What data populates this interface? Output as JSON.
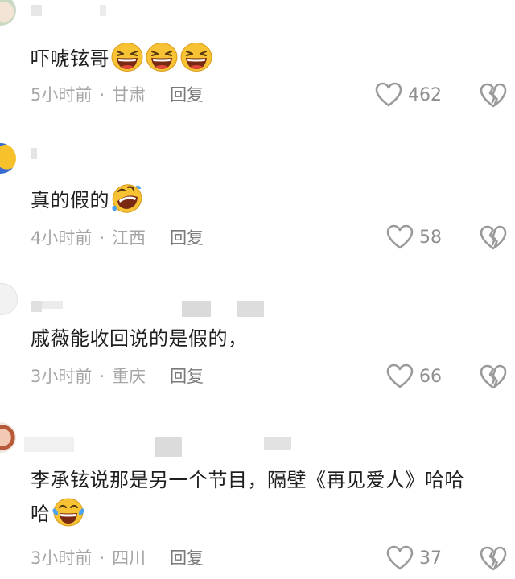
{
  "comments": [
    {
      "text": "吓唬铉哥",
      "emoji": [
        "laughing-face-icon",
        "laughing-face-icon",
        "laughing-face-icon"
      ],
      "time": "5小时前",
      "separator": "·",
      "location": "甘肃",
      "reply": "回复",
      "likes": "462"
    },
    {
      "text": "真的假的",
      "emoji": [
        "rolling-on-floor-laughing-icon"
      ],
      "time": "4小时前",
      "separator": "·",
      "location": "江西",
      "reply": "回复",
      "likes": "58"
    },
    {
      "text": "戚薇能收回说的是假的，",
      "emoji": [],
      "time": "3小时前",
      "separator": "·",
      "location": "重庆",
      "reply": "回复",
      "likes": "66"
    },
    {
      "text_line1": "李承铉说那是另一个节目，隔壁《再见爱人》哈哈",
      "text_line2": "哈",
      "emoji": [
        "tears-of-joy-face-icon"
      ],
      "time": "3小时前",
      "separator": "·",
      "location": "四川",
      "reply": "回复",
      "likes": "37"
    }
  ],
  "colors": {
    "meta_text": "#a6a6a6",
    "reply_text": "#7a7a7a",
    "icon_stroke": "#9a9a9a",
    "emoji_yellow": "#f7c233"
  }
}
